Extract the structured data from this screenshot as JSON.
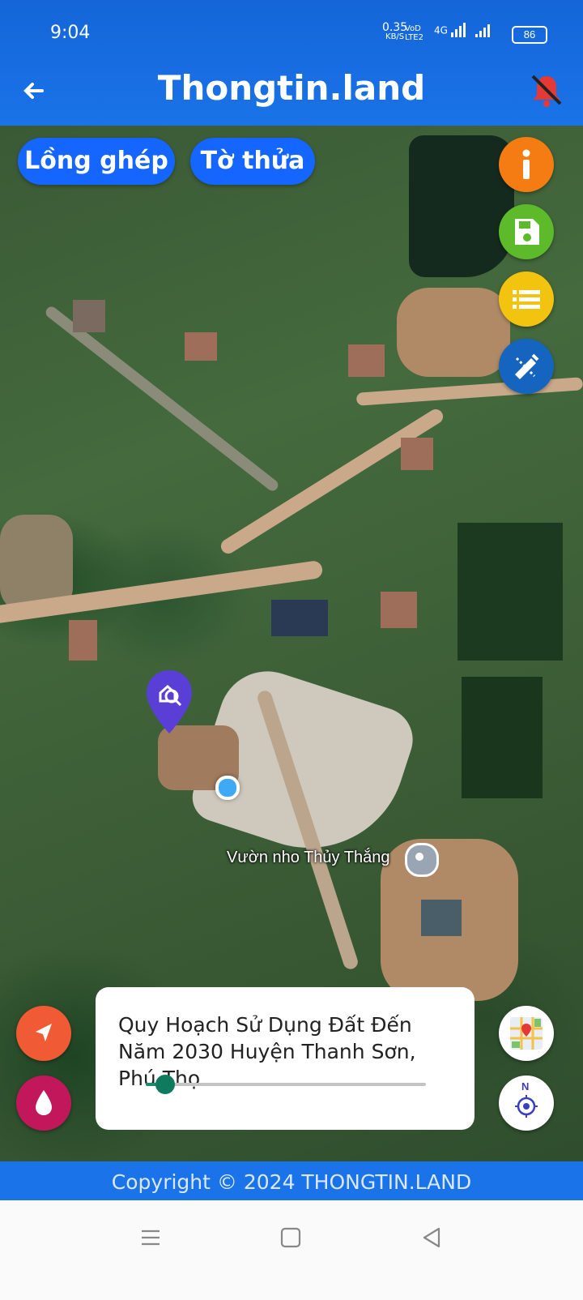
{
  "status_bar": {
    "time": "9:04",
    "net_speed": "0.35",
    "net_unit": "KB/S",
    "volte": "VoD LTE2",
    "signal": "4G",
    "battery": "86"
  },
  "header": {
    "title": "Thongtin.land",
    "back_icon": "back-arrow-icon",
    "mute_icon": "bell-off-icon"
  },
  "map": {
    "toggle_buttons": [
      "Lồng ghép",
      "Tờ thửa"
    ],
    "poi_label": "Vườn nho Thủy Thắng",
    "side_buttons": [
      {
        "name": "info",
        "icon": "info-icon",
        "color": "#f57c12"
      },
      {
        "name": "save",
        "icon": "save-icon",
        "color": "#5dba2a"
      },
      {
        "name": "list",
        "icon": "list-icon",
        "color": "#f2c40f"
      },
      {
        "name": "edit",
        "icon": "edit-ruler-icon",
        "color": "#1565c0"
      }
    ],
    "left_buttons": [
      {
        "name": "locate",
        "icon": "navigation-arrow-icon",
        "color": "#f05a35"
      },
      {
        "name": "opacity",
        "icon": "droplet-icon",
        "color": "#c2185b"
      }
    ],
    "right_bottom_buttons": [
      {
        "name": "basemap",
        "icon": "map-thumbnail-icon"
      },
      {
        "name": "compass",
        "icon": "compass-icon",
        "label": "N"
      }
    ]
  },
  "layer_card": {
    "title": "Quy Hoạch Sử Dụng Đất Đến Năm 2030 Huyện Thanh Sơn, Phú Thọ",
    "opacity": 0.07
  },
  "footer": {
    "copyright": "Copyright © 2024 THONGTIN.LAND"
  },
  "nav": {
    "menu_icon": "menu-icon",
    "home_icon": "home-square-icon",
    "back_icon": "back-triangle-icon"
  },
  "colors": {
    "primary": "#1a73e8",
    "toggle": "#1565ff",
    "slider": "#0f7a5e"
  }
}
